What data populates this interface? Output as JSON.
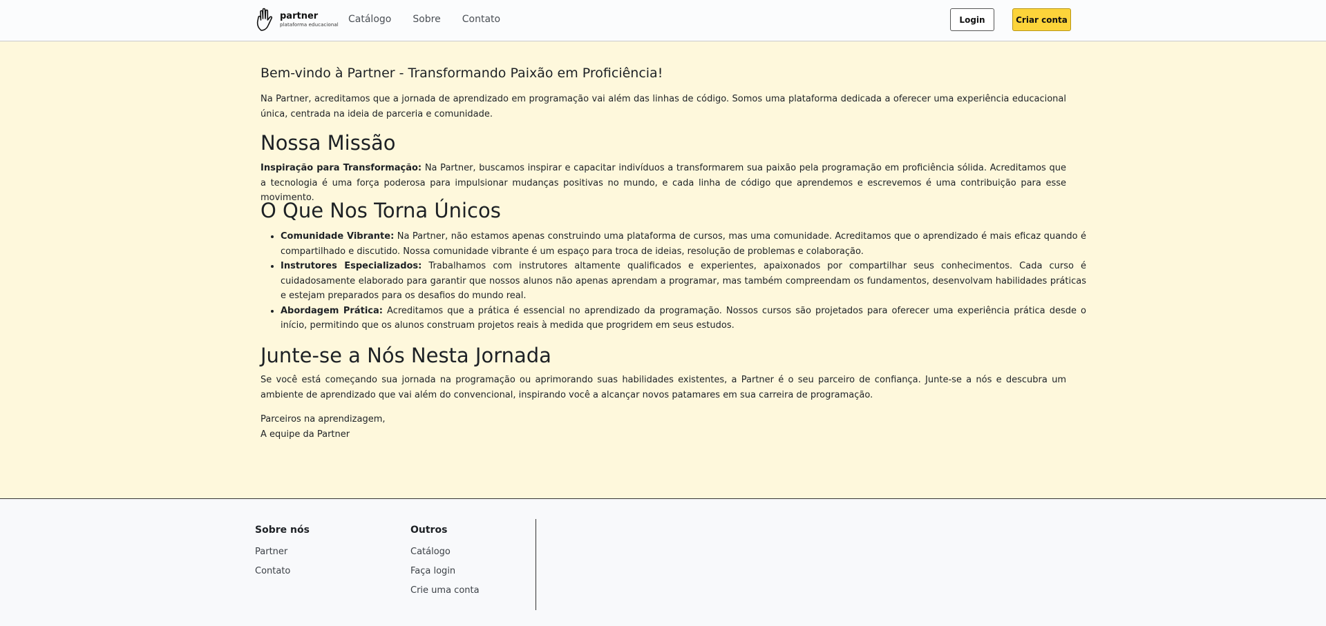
{
  "header": {
    "logo": {
      "name": "partner",
      "tagline": "plataforma educacional"
    },
    "nav": [
      "Catálogo",
      "Sobre",
      "Contato"
    ],
    "login_label": "Login",
    "signup_label": "Criar conta"
  },
  "main": {
    "welcome_title": "Bem-vindo à Partner - Transformando Paixão em Proficiência!",
    "intro": "Na Partner, acreditamos que a jornada de aprendizado em programação vai além das linhas de código. Somos uma plataforma dedicada a oferecer uma experiência educacional única, centrada na ideia de parceria e comunidade.",
    "mission_title": "Nossa Missão",
    "mission_lead": "Inspiração para Transformação:",
    "mission_text": " Na Partner, buscamos inspirar e capacitar indivíduos a transformarem sua paixão pela programação em proficiência sólida. Acreditamos que a tecnologia é uma força poderosa para impulsionar mudanças positivas no mundo, e cada linha de código que aprendemos e escrevemos é uma contribuição para esse movimento.",
    "unique_title": "O Que Nos Torna Únicos",
    "features": [
      {
        "lead": "Comunidade Vibrante:",
        "text": " Na Partner, não estamos apenas construindo uma plataforma de cursos, mas uma comunidade. Acreditamos que o aprendizado é mais eficaz quando é compartilhado e discutido. Nossa comunidade vibrante é um espaço para troca de ideias, resolução de problemas e colaboração."
      },
      {
        "lead": "Instrutores Especializados:",
        "text": " Trabalhamos com instrutores altamente qualificados e experientes, apaixonados por compartilhar seus conhecimentos. Cada curso é cuidadosamente elaborado para garantir que nossos alunos não apenas aprendam a programar, mas também compreendam os fundamentos, desenvolvam habilidades práticas e estejam preparados para os desafios do mundo real."
      },
      {
        "lead": "Abordagem Prática:",
        "text": " Acreditamos que a prática é essencial no aprendizado da programação. Nossos cursos são projetados para oferecer uma experiência prática desde o início, permitindo que os alunos construam projetos reais à medida que progridem em seus estudos."
      }
    ],
    "join_title": "Junte-se a Nós Nesta Jornada",
    "join_text": "Se você está começando sua jornada na programação ou aprimorando suas habilidades existentes, a Partner é o seu parceiro de confiança. Junte-se a nós e descubra um ambiente de aprendizado que vai além do convencional, inspirando você a alcançar novos patamares em sua carreira de programação.",
    "sign_line1": "Parceiros na aprendizagem,",
    "sign_line2": "A equipe da Partner"
  },
  "footer": {
    "about_title": "Sobre nós",
    "about_links": [
      "Partner",
      "Contato"
    ],
    "others_title": "Outros",
    "others_links": [
      "Catálogo",
      "Faça login",
      "Crie uma conta"
    ]
  },
  "colors": {
    "main_bg": "#fef8dc",
    "accent": "#fcd43a",
    "footer_bg": "#f8f9fb"
  }
}
